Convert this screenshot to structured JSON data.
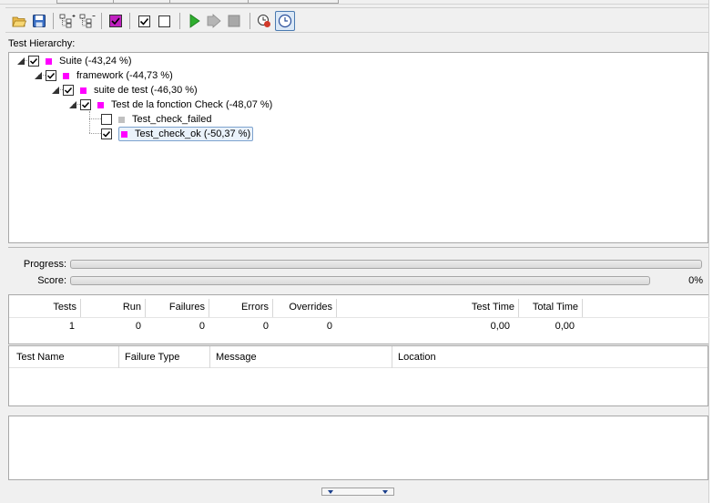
{
  "toolbar": {
    "icons": [
      "open-icon",
      "save-icon",
      "expand-all-icon",
      "collapse-all-icon",
      "check-failed-icon",
      "check-all-icon",
      "uncheck-all-icon",
      "run-icon",
      "run-selected-icon",
      "stop-icon",
      "reload-icon",
      "timer-icon"
    ]
  },
  "hierarchy": {
    "label": "Test Hierarchy:",
    "nodes": [
      {
        "text": "Suite (-43,24 %)",
        "color": "#ff00ff",
        "checked": true
      },
      {
        "text": "framework (-44,73 %)",
        "color": "#ff00ff",
        "checked": true
      },
      {
        "text": "suite de test (-46,30 %)",
        "color": "#ff00ff",
        "checked": true
      },
      {
        "text": "Test de la fonction Check (-48,07 %)",
        "color": "#ff00ff",
        "checked": true
      },
      {
        "text": "Test_check_failed",
        "color": "#c0c0c0",
        "checked": false
      },
      {
        "text": "Test_check_ok (-50,37 %)",
        "color": "#ff00ff",
        "checked": true
      }
    ]
  },
  "progress": {
    "label": "Progress:",
    "fraction": 0
  },
  "score": {
    "label": "Score:",
    "fraction": 0,
    "text": "0%"
  },
  "stats": {
    "headers": [
      "Tests",
      "Run",
      "Failures",
      "Errors",
      "Overrides",
      "Test Time",
      "Total Time"
    ],
    "values": [
      "1",
      "0",
      "0",
      "0",
      "0",
      "0,00",
      "0,00"
    ]
  },
  "failures": {
    "headers": [
      "Test Name",
      "Failure Type",
      "Message",
      "Location"
    ]
  }
}
